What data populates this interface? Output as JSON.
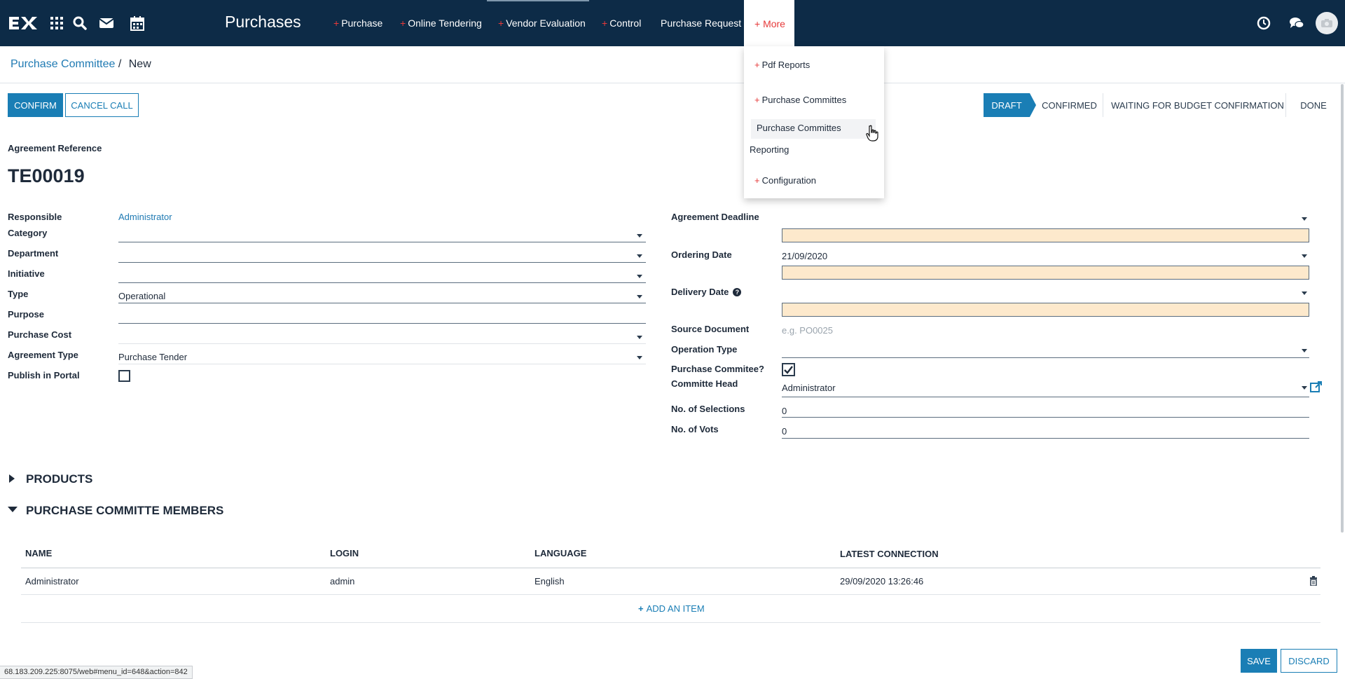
{
  "navbar": {
    "app_title": "Purchases",
    "menu": [
      {
        "label": "Purchase",
        "plus": "+"
      },
      {
        "label": "Online Tendering",
        "plus": "+"
      },
      {
        "label": "Vendor Evaluation",
        "plus": "+"
      },
      {
        "label": "Control",
        "plus": "+"
      },
      {
        "label": "Purchase Request",
        "plus": ""
      }
    ],
    "more_label": "+ More",
    "logo_text": "EX"
  },
  "dropdown": {
    "items": [
      {
        "label": "Pdf Reports",
        "plus": "+"
      },
      {
        "label": "Purchase Committes",
        "plus": "+"
      },
      {
        "label": "Purchase Committes",
        "plus": ""
      },
      {
        "label": "Reporting",
        "plus": ""
      },
      {
        "label": "Configuration",
        "plus": "+"
      }
    ]
  },
  "breadcrumb": {
    "parent": "Purchase Committee",
    "separator": "/",
    "current": "New"
  },
  "actions": {
    "confirm": "CONFIRM",
    "cancel_call": "CANCEL CALL"
  },
  "statusbar": {
    "stages": [
      "DRAFT",
      "CONFIRMED",
      "WAITING FOR BUDGET CONFIRMATION",
      "DONE"
    ],
    "active": "DRAFT"
  },
  "form": {
    "reference_label": "Agreement Reference",
    "reference": "TE00019",
    "left": {
      "responsible": {
        "label": "Responsible",
        "value": "Administrator"
      },
      "category": {
        "label": "Category",
        "value": ""
      },
      "department": {
        "label": "Department",
        "value": ""
      },
      "initiative": {
        "label": "Initiative",
        "value": ""
      },
      "type": {
        "label": "Type",
        "value": "Operational"
      },
      "purpose": {
        "label": "Purpose",
        "value": ""
      },
      "purchase_cost": {
        "label": "Purchase Cost",
        "value": ""
      },
      "agreement_type": {
        "label": "Agreement Type",
        "value": "Purchase Tender"
      },
      "publish_portal": {
        "label": "Publish in Portal",
        "checked": false
      }
    },
    "right": {
      "agreement_deadline": {
        "label": "Agreement Deadline",
        "value": ""
      },
      "ordering_date": {
        "label": "Ordering Date",
        "value": "21/09/2020"
      },
      "delivery_date": {
        "label": "Delivery Date",
        "help": "?",
        "value": ""
      },
      "source_document": {
        "label": "Source Document",
        "placeholder": "e.g. PO0025"
      },
      "operation_type": {
        "label": "Operation Type",
        "value": ""
      },
      "purchase_committee": {
        "label": "Purchase Commitee?",
        "checked": true
      },
      "committe_head": {
        "label": "Committe Head",
        "value": "Administrator"
      },
      "no_selections": {
        "label": "No. of Selections",
        "value": "0"
      },
      "no_votes": {
        "label": "No. of Vots",
        "value": "0"
      }
    }
  },
  "sections": {
    "products": "PRODUCTS",
    "members": "PURCHASE COMMITTE MEMBERS"
  },
  "members_table": {
    "headers": [
      "NAME",
      "LOGIN",
      "LANGUAGE",
      "LATEST CONNECTION"
    ],
    "rows": [
      {
        "name": "Administrator",
        "login": "admin",
        "language": "English",
        "latest": "29/09/2020 13:26:46"
      }
    ],
    "add_item": "ADD AN ITEM"
  },
  "footer": {
    "save": "SAVE",
    "discard": "DISCARD"
  },
  "status_url": "68.183.209.225:8075/web#menu_id=648&action=842",
  "colors": {
    "navbar": "#0d2b47",
    "primary": "#1a7eb5",
    "required": "#fde9cc",
    "menu_plus": "#e63a3a"
  }
}
